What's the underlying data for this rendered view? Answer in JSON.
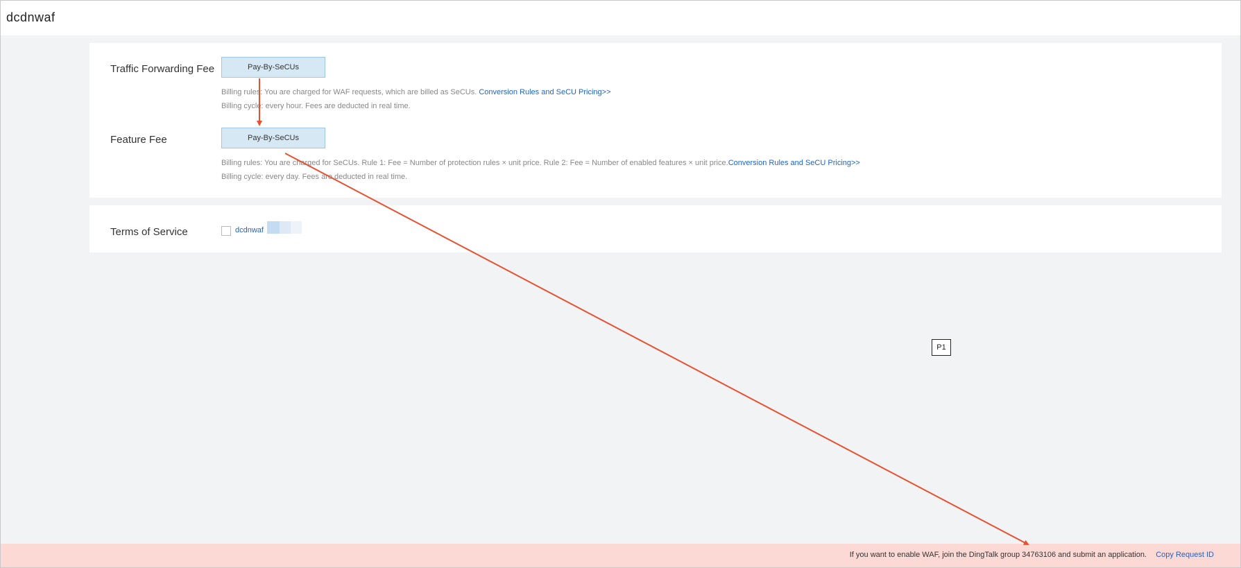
{
  "app": {
    "title": "dcdnwaf"
  },
  "billing": {
    "traffic_fee": {
      "label": "Traffic Forwarding Fee",
      "mode_button": "Pay-By-SeCUs",
      "rules_text": "Billing rules: You are charged for WAF requests, which are billed as SeCUs.",
      "rules_link": "Conversion Rules and SeCU Pricing>>",
      "cycle_text": "Billing cycle: every hour. Fees are deducted in real time."
    },
    "feature_fee": {
      "label": "Feature Fee",
      "mode_button": "Pay-By-SeCUs",
      "rules_text": "Billing rules: You are charged for SeCUs. Rule 1: Fee = Number of protection rules × unit price. Rule 2: Fee = Number of enabled features × unit price.",
      "rules_link": "Conversion Rules and SeCU Pricing>>",
      "cycle_text": "Billing cycle: every day. Fees are deducted in real time."
    }
  },
  "terms": {
    "label": "Terms of Service",
    "agreement_link": "dcdnwaf",
    "checked": false
  },
  "annotation": {
    "marker": "P1",
    "arrow_color": "#e8502f"
  },
  "footer": {
    "message": "If you want to enable WAF, join the DingTalk group 34763106 and submit an application.",
    "copy_link": "Copy Request ID"
  }
}
